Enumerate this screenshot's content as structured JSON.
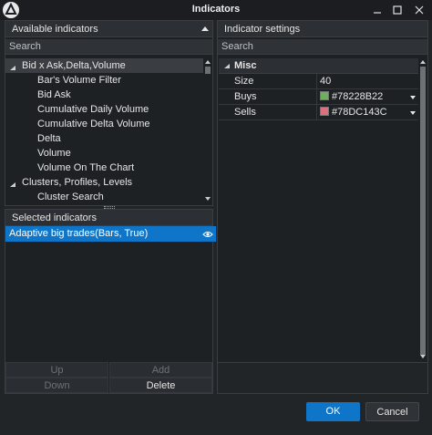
{
  "window": {
    "title": "Indicators"
  },
  "available": {
    "header": "Available indicators",
    "search_placeholder": "Search",
    "groups": [
      {
        "label": "Bid x Ask,Delta,Volume",
        "items": [
          "Bar's Volume Filter",
          "Bid Ask",
          "Cumulative Daily Volume",
          "Cumulative Delta Volume",
          "Delta",
          "Volume",
          "Volume On The Chart"
        ]
      },
      {
        "label": "Clusters, Profiles, Levels",
        "items": [
          "Cluster Search"
        ]
      }
    ]
  },
  "selected": {
    "header": "Selected indicators",
    "items": [
      "Adaptive big trades(Bars, True)"
    ],
    "buttons": {
      "up": "Up",
      "add": "Add",
      "down": "Down",
      "delete": "Delete"
    }
  },
  "settings": {
    "header": "Indicator settings",
    "search_placeholder": "Search",
    "category": "Misc",
    "properties": [
      {
        "name": "Size",
        "value": "40"
      },
      {
        "name": "Buys",
        "value": "#78228B22",
        "swatch": "#6fae5e"
      },
      {
        "name": "Sells",
        "value": "#78DC143C",
        "swatch": "#d9717f"
      }
    ]
  },
  "dialog": {
    "ok": "OK",
    "cancel": "Cancel"
  },
  "colors": {
    "accent": "#0f75c8",
    "background": "#222528",
    "panel": "#1e2124"
  },
  "icons": [
    "app-logo-icon",
    "minimize-icon",
    "maximize-icon",
    "close-icon",
    "collapse-triangle-icon",
    "scroll-up-icon",
    "scroll-down-icon",
    "eye-icon",
    "dropdown-arrow-icon"
  ]
}
